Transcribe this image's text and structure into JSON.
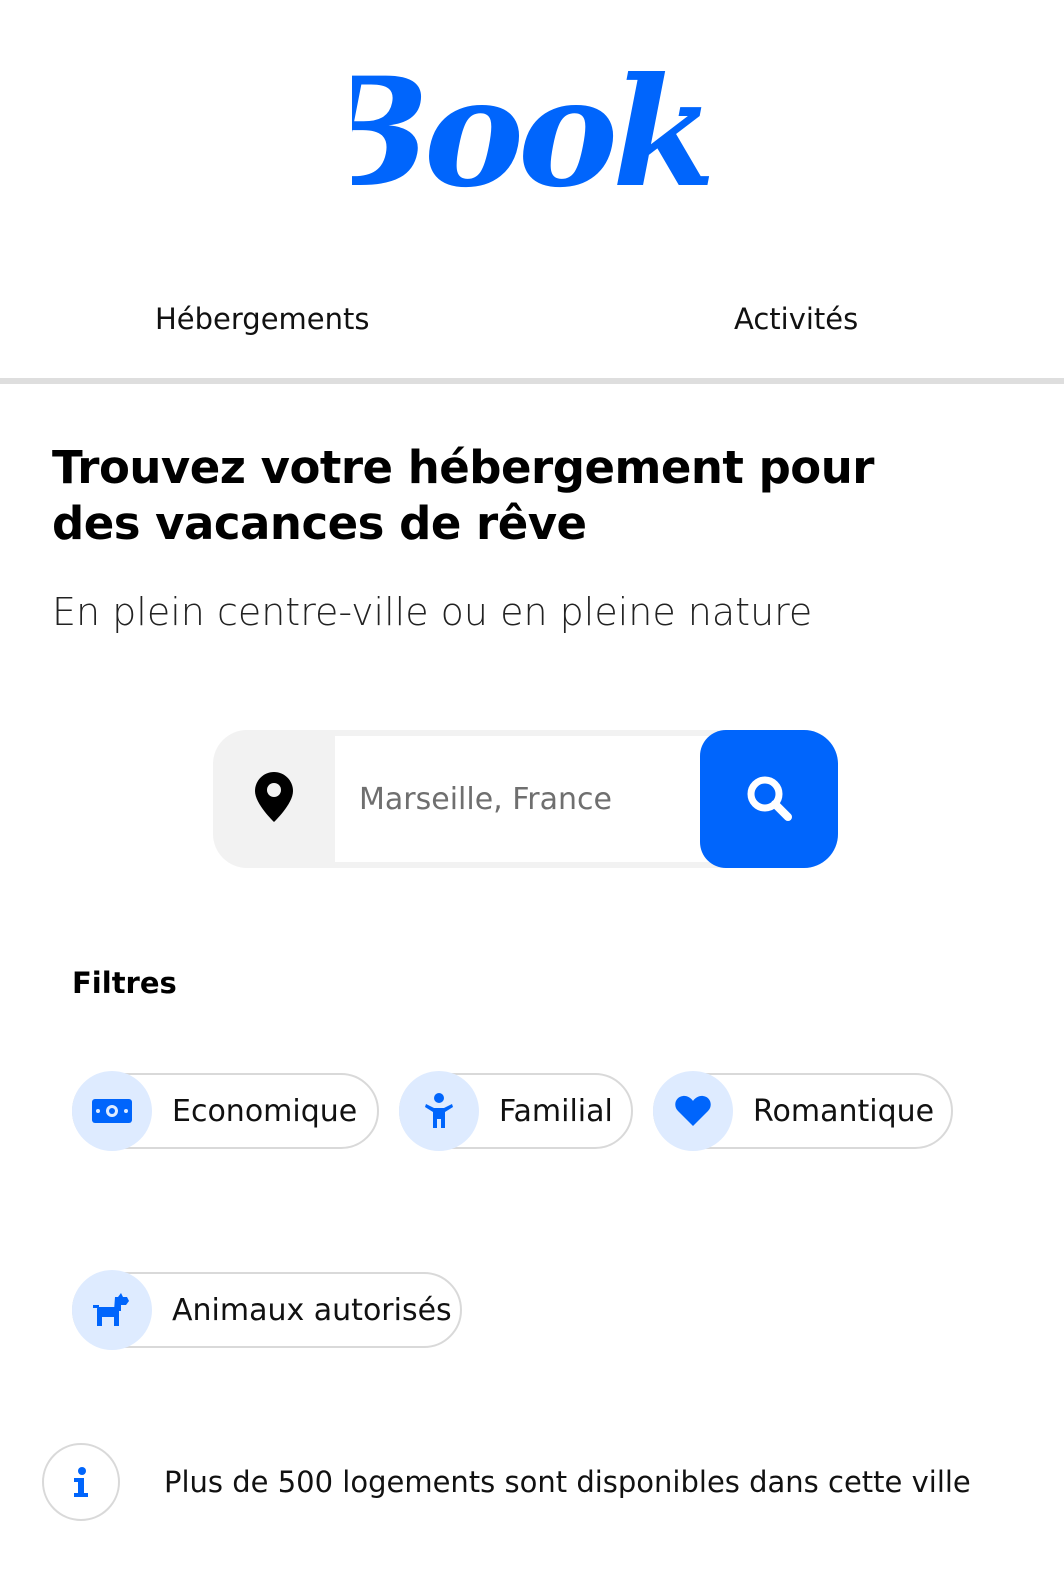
{
  "brand": {
    "name": "Booki",
    "color": "#0065fc"
  },
  "nav": {
    "items": [
      {
        "label": "Hébergements"
      },
      {
        "label": "Activités"
      }
    ]
  },
  "hero": {
    "title": "Trouvez votre hébergement pour des vacances de rêve",
    "subtitle": "En plein centre-ville ou en pleine nature"
  },
  "search": {
    "placeholder": "Marseille, France",
    "value": "",
    "location_icon": "map-pin-icon",
    "button_icon": "search-icon"
  },
  "filters": {
    "title": "Filtres",
    "items": [
      {
        "label": "Economique",
        "icon": "money-bill-icon"
      },
      {
        "label": "Familial",
        "icon": "child-icon"
      },
      {
        "label": "Romantique",
        "icon": "heart-icon"
      },
      {
        "label": "Animaux autorisés",
        "icon": "dog-icon"
      }
    ]
  },
  "info": {
    "icon": "info-icon",
    "text": "Plus de 500 logements sont disponibles dans cette ville"
  }
}
